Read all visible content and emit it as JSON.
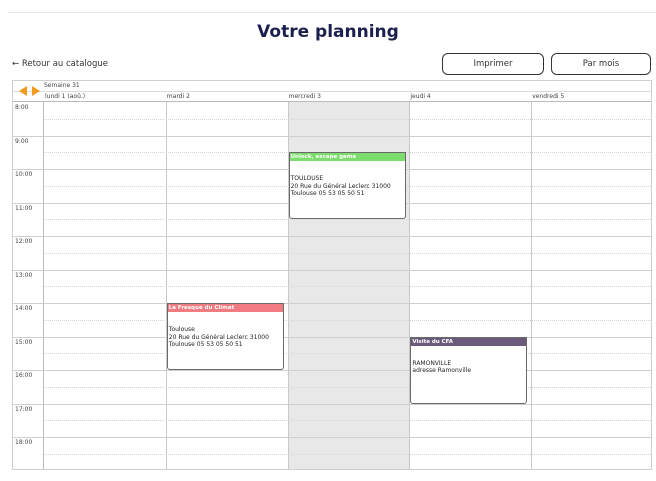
{
  "page": {
    "title": "Votre planning",
    "back_label": "← Retour au catalogue",
    "print_label": "Imprimer",
    "month_label": "Par mois"
  },
  "calendar": {
    "week_label": "Semaine 31",
    "days": [
      "lundi 1 (aoû.)",
      "mardi 2",
      "mercredi 3",
      "jeudi 4",
      "vendredi 5"
    ],
    "hours": [
      "8:00",
      "9:00",
      "10:00",
      "11:00",
      "12:00",
      "13:00",
      "14:00",
      "15:00",
      "16:00",
      "17:00",
      "18:00"
    ],
    "highlighted_day": 2,
    "events": [
      {
        "title": "Unlock, escape game",
        "day": 2,
        "start": "9:30",
        "end": "11:30",
        "color": "#7ddc6e",
        "lines": [
          "TOULOUSE",
          "20 Rue du Général Leclerc 31000",
          "Toulouse 05 53 05 50 51"
        ]
      },
      {
        "title": "La Fresque du Climat",
        "day": 1,
        "start": "14:00",
        "end": "16:00",
        "color": "#f07b80",
        "lines": [
          "Toulouse",
          "20 Rue du Général Leclerc 31000",
          "Toulouse 05 53 05 50 51"
        ]
      },
      {
        "title": "Visite du CFA",
        "day": 3,
        "start": "15:00",
        "end": "17:00",
        "color": "#6c5a7a",
        "lines": [
          "RAMONVILLE",
          "adresse Ramonville"
        ]
      }
    ]
  }
}
